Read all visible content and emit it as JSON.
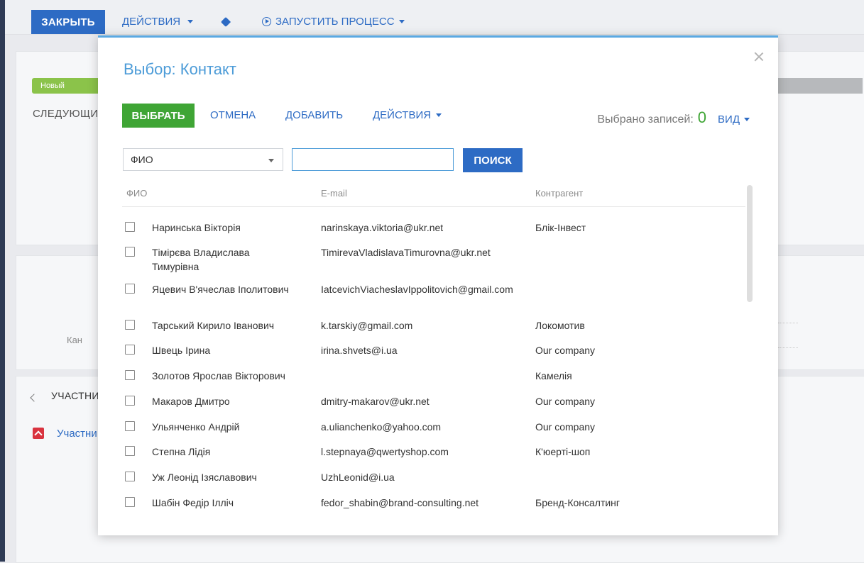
{
  "background": {
    "toolbar": {
      "close_label": "ЗАКРЫТЬ",
      "actions_label": "ДЕЙСТВИЯ",
      "run_process_label": "ЗАПУСТИТЬ ПРОЦЕСС"
    },
    "stage_label": "Новый",
    "next_steps_label": "СЛЕДУЮЩИ",
    "field_label_partial": "Кан",
    "participants_tab": "УЧАСТНИ",
    "participants_group": "Участни"
  },
  "modal": {
    "title": "Выбор: Контакт",
    "buttons": {
      "select": "ВЫБРАТЬ",
      "cancel": "ОТМЕНА",
      "add": "ДОБАВИТЬ",
      "actions": "ДЕЙСТВИЯ",
      "view": "ВИД"
    },
    "selected_label": "Выбрано записей:",
    "selected_count": "0",
    "filter": {
      "field": "ФИО",
      "value": "",
      "search_label": "ПОИСК"
    },
    "columns": [
      "ФИО",
      "E-mail",
      "Контрагент"
    ],
    "rows": [
      {
        "name": "Наринська Вікторія",
        "email": "narinskaya.viktoria@ukr.net",
        "account": "Блік-Інвест"
      },
      {
        "name": "Тімірєва Владислава Тимурівна",
        "email": "TimirevaVladislavaTimurovna@ukr.net",
        "account": ""
      },
      {
        "name": "Яцевич В'ячеслав Іполитович",
        "email": "IatcevichViacheslavIppolitovich@gmail.com",
        "account": ""
      },
      {
        "name": "Тарський Кирило Іванович",
        "email": "k.tarskiy@gmail.com",
        "account": "Локомотив"
      },
      {
        "name": "Швець Ірина",
        "email": "irina.shvets@i.ua",
        "account": "Our company"
      },
      {
        "name": "Золотов Ярослав Вікторович",
        "email": "",
        "account": "Камелія"
      },
      {
        "name": "Макаров Дмитро",
        "email": "dmitry-makarov@ukr.net",
        "account": "Our company"
      },
      {
        "name": "Ульянченко Андрій",
        "email": "a.ulianchenko@yahoo.com",
        "account": "Our company"
      },
      {
        "name": "Степна Лідія",
        "email": "l.stepnaya@qwertyshop.com",
        "account": "К'юерті-шоп"
      },
      {
        "name": "Уж Леонід Ізяславович",
        "email": "UzhLeonid@i.ua",
        "account": ""
      },
      {
        "name": "Шабін Федір Ілліч",
        "email": "fedor_shabin@brand-consulting.net",
        "account": "Бренд-Консалтинг"
      }
    ]
  },
  "colors": {
    "accent_blue": "#2d6bc4",
    "title_blue": "#4d9cd8",
    "select_green": "#3fa535"
  }
}
